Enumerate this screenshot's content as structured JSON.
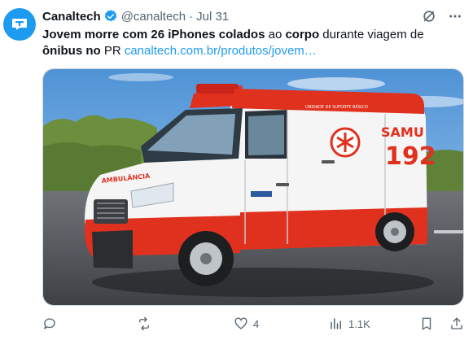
{
  "post": {
    "author_name": "Canaltech",
    "handle": "@canaltech",
    "separator": "·",
    "date": "Jul 31",
    "text": {
      "b1": "Jovem morre com 26 iPhones colados",
      "t1": " ao ",
      "b2": "corpo",
      "t2": " durante viagem de ",
      "b3": "ônibus no",
      "t3": " PR ",
      "link": "canaltech.com.br/produtos/jovem…"
    },
    "media": {
      "vehicle_text_service": "SAMU",
      "vehicle_text_number": "192",
      "vehicle_hood_text": "AMBULÂNCIA",
      "vehicle_roof_text": "UNIDADE DE SUPORTE BÁSICO"
    }
  },
  "actions": {
    "replies": "",
    "reposts": "",
    "likes": "4",
    "views": "1.1K"
  },
  "colors": {
    "brand": "#1d9bf0",
    "ambulance_red": "#e0301e",
    "sky": "#6aa8e0"
  },
  "icons": [
    "canaltech-logo-icon",
    "verified-badge-icon",
    "grok-icon",
    "more-icon",
    "reply-icon",
    "repost-icon",
    "like-icon",
    "views-icon",
    "bookmark-icon",
    "share-icon"
  ]
}
